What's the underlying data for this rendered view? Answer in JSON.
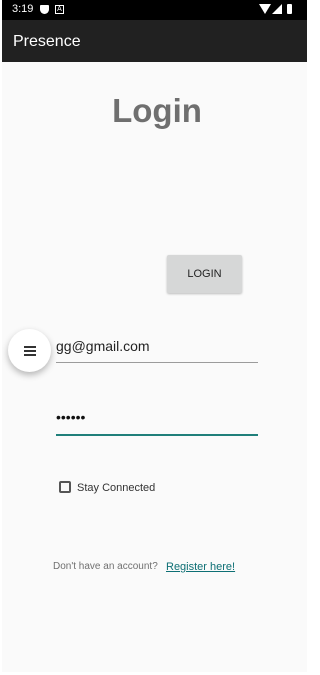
{
  "status_bar": {
    "time": "3:19",
    "icons": [
      "shield-icon",
      "a-icon",
      "wifi-icon",
      "signal-icon",
      "battery-icon"
    ]
  },
  "app_bar": {
    "title": "Presence"
  },
  "login": {
    "heading": "Login",
    "button_label": "LOGIN",
    "email_value": "gg@gmail.com",
    "password_value": "••••••",
    "stay_connected_label": "Stay Connected",
    "account_prompt": "Don't have an account?",
    "register_link": "Register here!"
  },
  "colors": {
    "app_bar": "#212121",
    "title_text": "#6f6f6f",
    "accent": "#1f7f7a",
    "button": "#d6d7d7"
  }
}
